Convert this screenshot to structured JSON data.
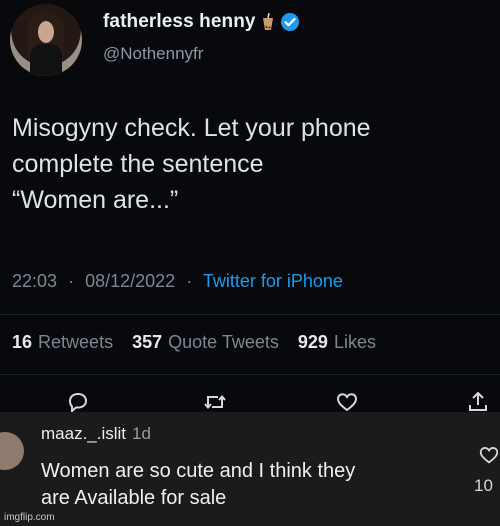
{
  "tweet": {
    "display_name": "fatherless henny",
    "handle": "@Nothennyfr",
    "text_lines": [
      "Misogyny check. Let your phone",
      "complete the sentence",
      "“Women are...”"
    ],
    "time": "22:03",
    "date": "08/12/2022",
    "source": "Twitter for iPhone",
    "separator": "·",
    "stats": {
      "retweets_count": "16",
      "retweets_label": "Retweets",
      "quotes_count": "357",
      "quotes_label": "Quote Tweets",
      "likes_count": "929",
      "likes_label": "Likes"
    },
    "icons": [
      "speech-bubble-emoji-icon",
      "verified-badge-icon",
      "reply-icon",
      "retweet-icon",
      "like-icon",
      "share-icon"
    ],
    "colors": {
      "background": "#07090d",
      "link": "#1d9bf0",
      "muted": "#7d8791"
    }
  },
  "comment": {
    "username": "maaz._.islit",
    "time": "1d",
    "text_lines": [
      "Women are so cute and I think they",
      "are Available for sale"
    ],
    "like_count": "10",
    "colors": {
      "background": "#1b1b1b"
    }
  },
  "watermark": "imgflip.com"
}
